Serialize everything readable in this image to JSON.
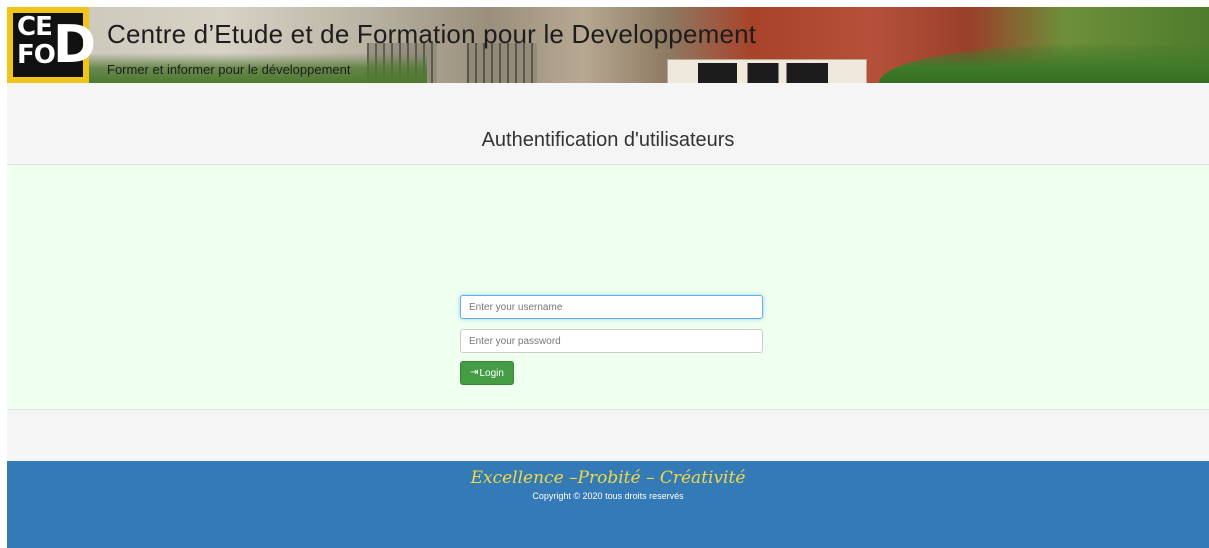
{
  "header": {
    "title": "Centre d’Etude et de Formation pour le Developpement",
    "slogan": "Former et informer pour le développement",
    "logo_text": "CEFOD",
    "sign_text": "CEFOD"
  },
  "page": {
    "title": "Authentification d'utilisateurs"
  },
  "login": {
    "username_placeholder": "Enter your username",
    "password_placeholder": "Enter your password",
    "button_label": "Login",
    "button_icon": "sign-in-icon"
  },
  "footer": {
    "motto": "Excellence –Probité – Créativité",
    "copyright": "Copyright © 2020 tous droits reservés"
  },
  "colors": {
    "footer_bg": "#337ab7",
    "login_panel_bg": "#effff0",
    "button_bg": "#449d44",
    "motto_color": "#f0d84a"
  }
}
